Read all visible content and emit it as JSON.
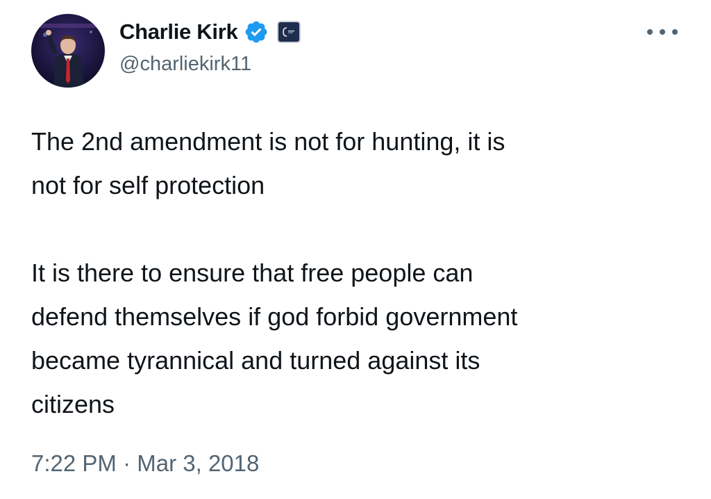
{
  "author": {
    "display_name": "Charlie Kirk",
    "handle": "@charliekirk11",
    "verified_icon": "verified-badge-icon",
    "affiliate_icon": "organization-affiliate-badge"
  },
  "tweet": {
    "paragraphs": [
      "The 2nd amendment is not for hunting, it is\nnot for self protection",
      "It is there to ensure that free people can\ndefend themselves if god forbid government\nbecame tyrannical and turned against its\ncitizens"
    ],
    "time": "7:22 PM",
    "separator": "·",
    "date": "Mar 3, 2018"
  },
  "icons": {
    "more": "more-options-icon"
  },
  "colors": {
    "text_primary": "#0f1419",
    "text_secondary": "#536471",
    "verified_blue": "#1d9bf0"
  }
}
